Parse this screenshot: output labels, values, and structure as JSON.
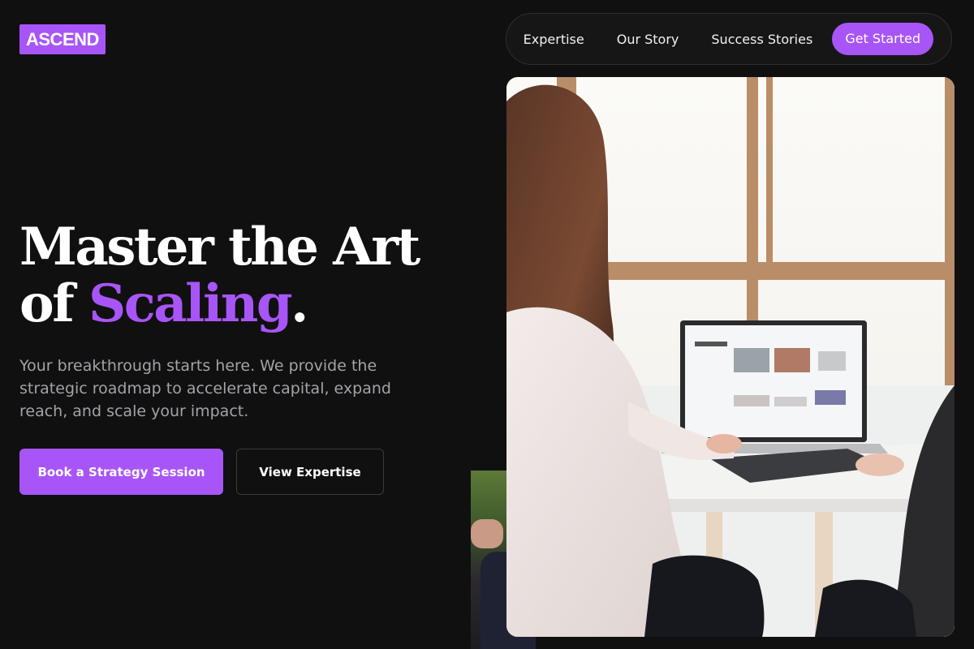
{
  "brand": {
    "logo_text": "ASCEND",
    "accent": "#a855f7"
  },
  "nav": {
    "items": [
      "Expertise",
      "Our Story",
      "Success Stories"
    ],
    "cta": "Get Started"
  },
  "hero": {
    "headline_line1": "Master the Art",
    "headline_line2_prefix": "of ",
    "headline_accent": "Scaling",
    "headline_suffix": ".",
    "subtitle": "Your breakthrough starts here. We provide the strategic roadmap to accelerate capital, expand reach, and scale your impact.",
    "primary_button": "Book a Strategy Session",
    "secondary_button": "View Expertise"
  },
  "images": {
    "main_photo": "woman-working-on-laptop-photo",
    "secondary_photo": "person-with-tablet-outdoors-photo"
  }
}
